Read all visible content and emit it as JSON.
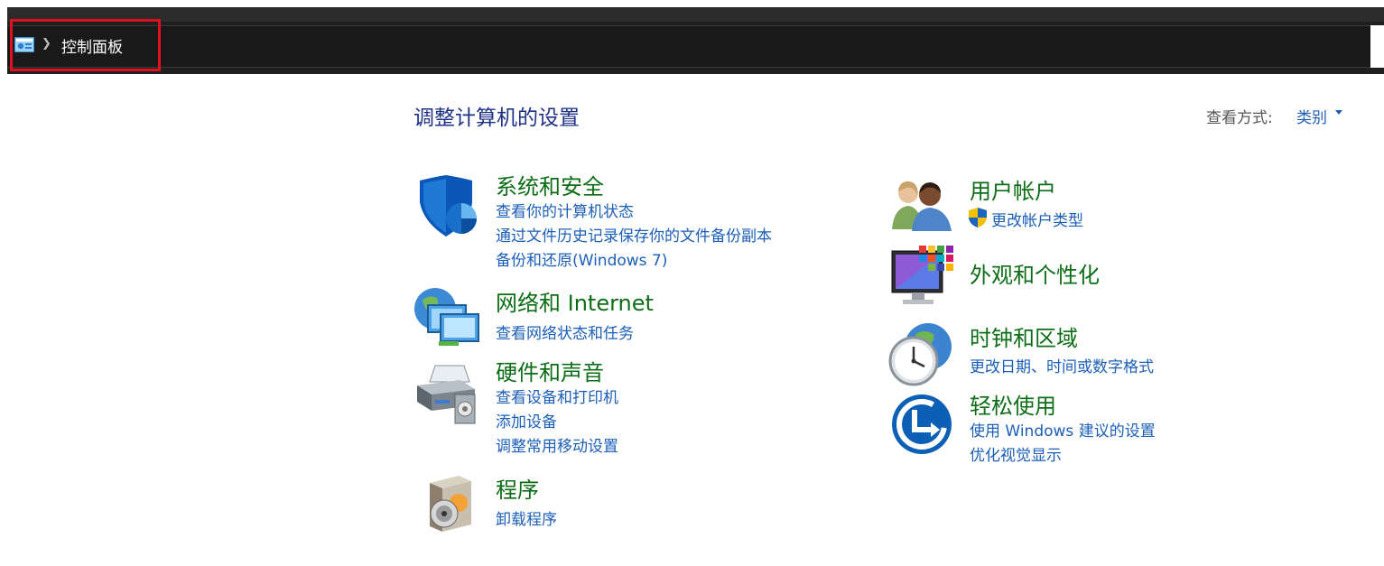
{
  "breadcrumb": {
    "root_icon": "control-panel-icon",
    "separator_icon": "chevron-right-icon",
    "label": "控制面板"
  },
  "header": {
    "title": "调整计算机的设置",
    "view_by_label": "查看方式:",
    "view_by_value": "类别",
    "view_by_icon": "caret-down-icon"
  },
  "categories_left": [
    {
      "icon": "shield-icon",
      "title": "系统和安全",
      "links": [
        "查看你的计算机状态",
        "通过文件历史记录保存你的文件备份副本",
        "备份和还原(Windows 7)"
      ]
    },
    {
      "icon": "network-globe-icon",
      "title": "网络和 Internet",
      "links": [
        "查看网络状态和任务"
      ]
    },
    {
      "icon": "printer-icon",
      "title": "硬件和声音",
      "links": [
        "查看设备和打印机",
        "添加设备",
        "调整常用移动设置"
      ]
    },
    {
      "icon": "programs-disc-icon",
      "title": "程序",
      "links": [
        "卸载程序"
      ]
    }
  ],
  "categories_right": [
    {
      "icon": "users-icon",
      "title": "用户帐户",
      "links": [
        "更改帐户类型"
      ],
      "link_icon": "uac-shield-icon"
    },
    {
      "icon": "appearance-monitor-icon",
      "title": "外观和个性化",
      "links": []
    },
    {
      "icon": "clock-globe-icon",
      "title": "时钟和区域",
      "links": [
        "更改日期、时间或数字格式"
      ]
    },
    {
      "icon": "ease-of-access-icon",
      "title": "轻松使用",
      "links": [
        "使用 Windows 建议的设置",
        "优化视觉显示"
      ]
    }
  ],
  "colors": {
    "chrome_background": "#1f1f1f",
    "highlight_border": "#e01020",
    "page_title": "#1e3287",
    "category_title": "#0e6e17",
    "link": "#1b5fb8"
  }
}
